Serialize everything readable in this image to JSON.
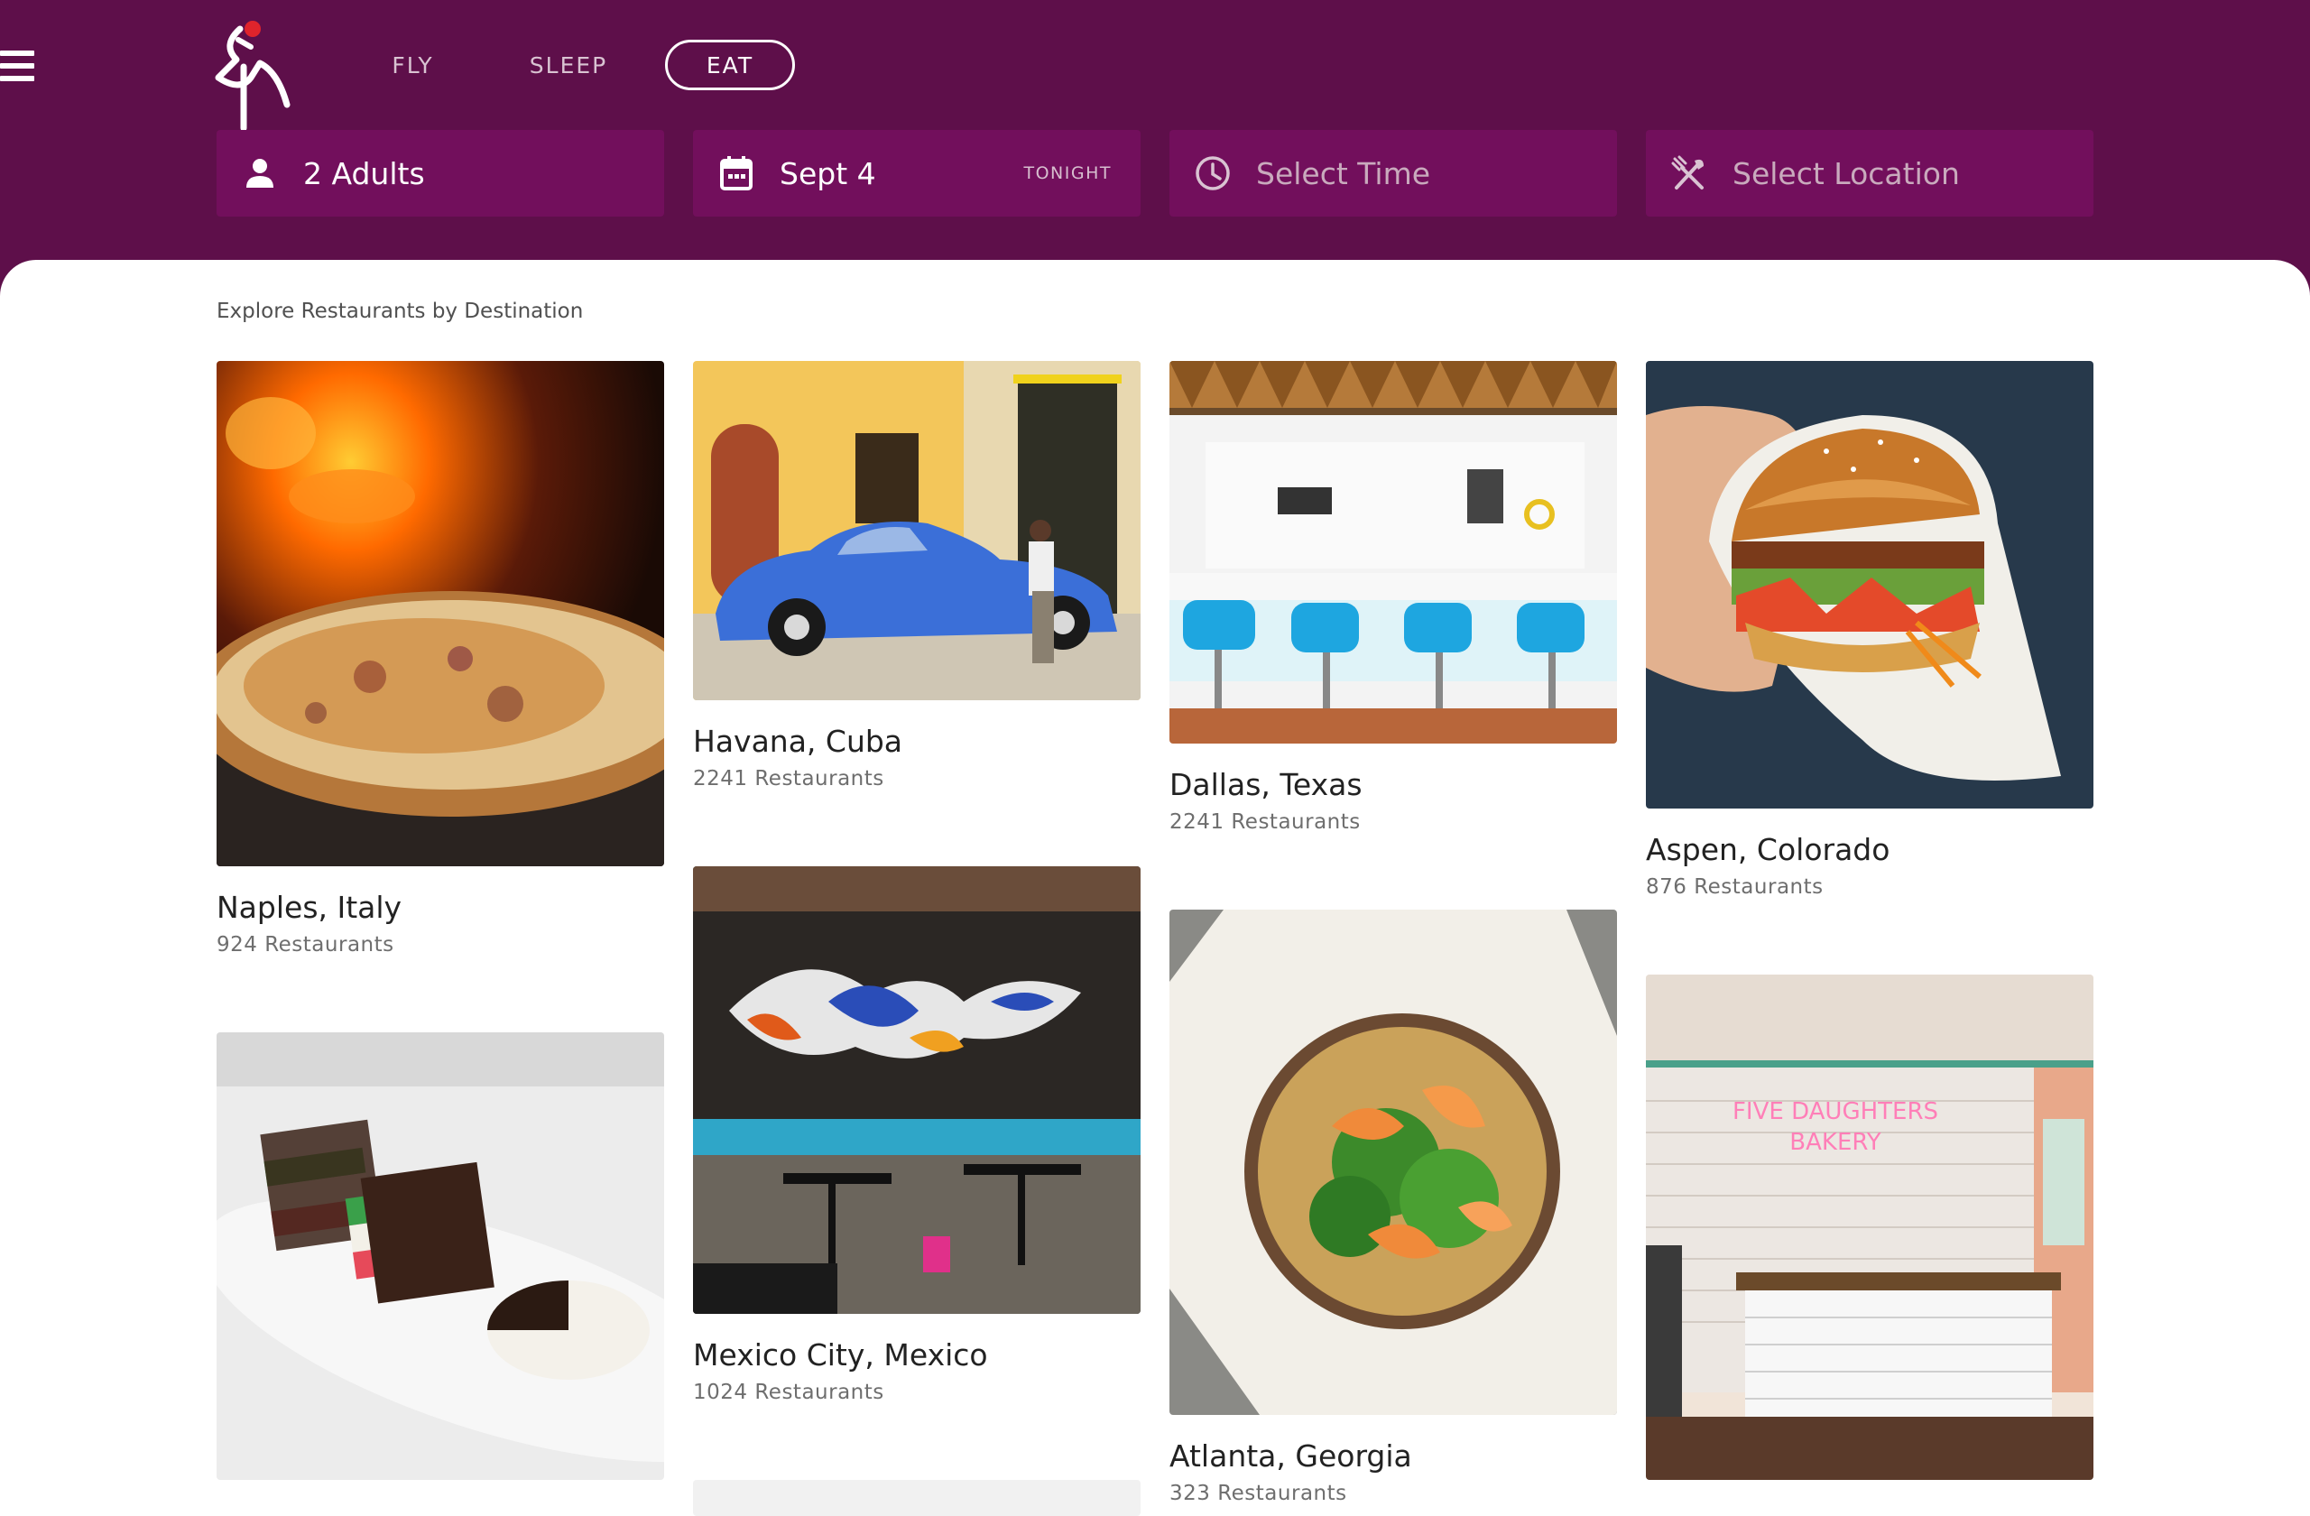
{
  "header": {
    "menu_icon": "hamburger-menu-icon",
    "logo_icon": "crane-bird-logo",
    "nav_tabs": [
      {
        "label": "FLY",
        "active": false
      },
      {
        "label": "SLEEP",
        "active": false
      },
      {
        "label": "EAT",
        "active": true
      }
    ],
    "filters": {
      "guests": {
        "icon": "person-icon",
        "value": "2 Adults"
      },
      "date": {
        "icon": "calendar-icon",
        "value": "Sept 4",
        "tag": "TONIGHT"
      },
      "time": {
        "icon": "clock-icon",
        "placeholder": "Select Time"
      },
      "location": {
        "icon": "fork-knife-icon",
        "placeholder": "Select Location"
      }
    }
  },
  "main": {
    "section_title": "Explore Restaurants by Destination",
    "destinations": [
      {
        "city": "Naples, Italy",
        "count": "924 Restaurants",
        "photo": "pizza"
      },
      {
        "city": "Havana, Cuba",
        "count": "2241 Restaurants",
        "photo": "blue-vintage-car"
      },
      {
        "city": "Dallas, Texas",
        "count": "2241 Restaurants",
        "photo": "diner-counter"
      },
      {
        "city": "Aspen, Colorado",
        "count": "876 Restaurants",
        "photo": "burger"
      },
      {
        "city": "Mexico City, Mexico",
        "count": "1024 Restaurants",
        "photo": "restaurant-interior"
      },
      {
        "city": "Atlanta, Georgia",
        "count": "323 Restaurants",
        "photo": "shrimp-bowl"
      }
    ]
  },
  "colors": {
    "header_bg": "#5e0f4a",
    "filter_bg": "#720f5c",
    "accent_red": "#e0242c",
    "text_dark": "#222222",
    "text_muted": "#6e6e6e"
  }
}
